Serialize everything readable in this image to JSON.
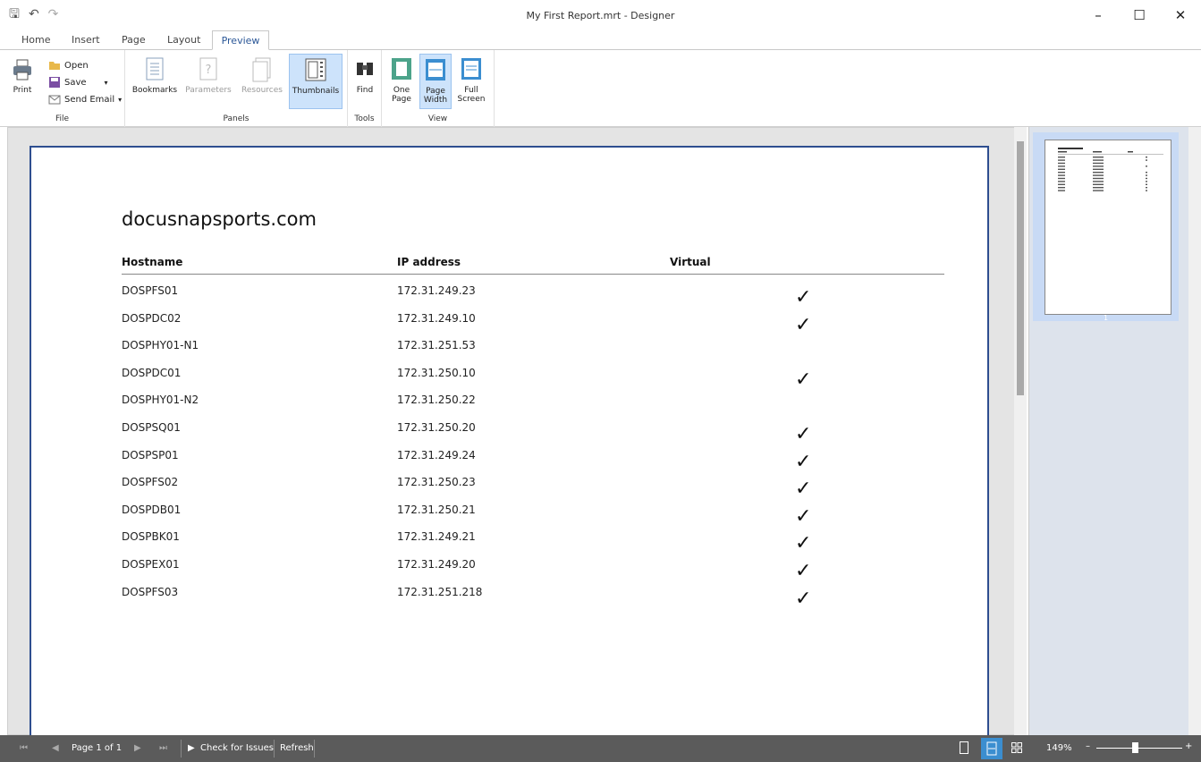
{
  "window": {
    "title": "My First Report.mrt - Designer",
    "controls": {
      "minimize": "–",
      "maximize": "☐",
      "close": "✕"
    }
  },
  "quick_access": {
    "save": "🖫",
    "undo": "↶",
    "redo": "↷"
  },
  "tabs": [
    {
      "label": "Home",
      "active": false
    },
    {
      "label": "Insert",
      "active": false
    },
    {
      "label": "Page",
      "active": false
    },
    {
      "label": "Layout",
      "active": false
    },
    {
      "label": "Preview",
      "active": true
    }
  ],
  "ribbon": {
    "file": {
      "label": "File",
      "print": "Print",
      "open": "Open",
      "save": "Save",
      "send_email": "Send Email"
    },
    "panels": {
      "label": "Panels",
      "bookmarks": "Bookmarks",
      "parameters": "Parameters",
      "resources": "Resources",
      "thumbnails": "Thumbnails"
    },
    "tools": {
      "label": "Tools",
      "find": "Find"
    },
    "view": {
      "label": "View",
      "one_page_1": "One",
      "one_page_2": "Page",
      "page_width_1": "Page",
      "page_width_2": "Width",
      "full_screen_1": "Full",
      "full_screen_2": "Screen"
    }
  },
  "report": {
    "company": "docusnapsports.com",
    "columns": [
      "Hostname",
      "IP address",
      "Virtual"
    ],
    "rows": [
      {
        "hostname": "DOSPFS01",
        "ip": "172.31.249.23",
        "virtual": true
      },
      {
        "hostname": "DOSPDC02",
        "ip": "172.31.249.10",
        "virtual": true
      },
      {
        "hostname": "DOSPHY01-N1",
        "ip": "172.31.251.53",
        "virtual": false
      },
      {
        "hostname": "DOSPDC01",
        "ip": "172.31.250.10",
        "virtual": true
      },
      {
        "hostname": "DOSPHY01-N2",
        "ip": "172.31.250.22",
        "virtual": false
      },
      {
        "hostname": "DOSPSQ01",
        "ip": "172.31.250.20",
        "virtual": true
      },
      {
        "hostname": "DOSPSP01",
        "ip": "172.31.249.24",
        "virtual": true
      },
      {
        "hostname": "DOSPFS02",
        "ip": "172.31.250.23",
        "virtual": true
      },
      {
        "hostname": "DOSPDB01",
        "ip": "172.31.250.21",
        "virtual": true
      },
      {
        "hostname": "DOSPBK01",
        "ip": "172.31.249.21",
        "virtual": true
      },
      {
        "hostname": "DOSPEX01",
        "ip": "172.31.249.20",
        "virtual": true
      },
      {
        "hostname": "DOSPFS03",
        "ip": "172.31.251.218",
        "virtual": true
      }
    ],
    "check_glyph": "✓"
  },
  "thumbnails": {
    "page_number": "1"
  },
  "statusbar": {
    "page_info": "Page 1 of 1",
    "check_issues": "Check for Issues",
    "refresh": "Refresh",
    "zoom": "149%",
    "zoom_out": "–",
    "zoom_in": "+"
  },
  "colors": {
    "accent": "#2b5797",
    "selected": "#cde3fb",
    "statusbar": "#5b5b5b"
  }
}
